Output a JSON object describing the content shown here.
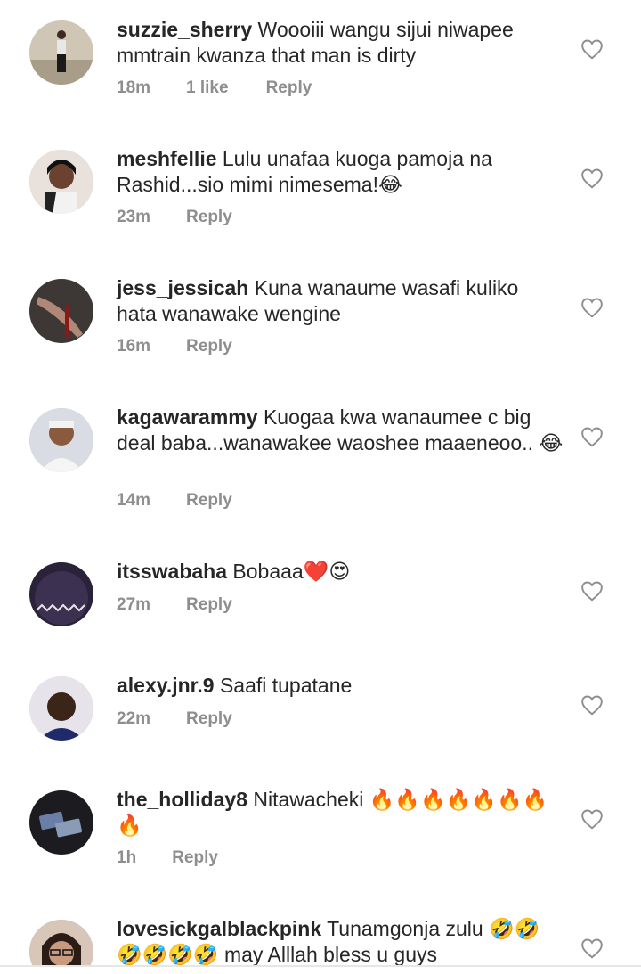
{
  "comments": [
    {
      "username": "suzzie_sherry",
      "text": "Woooiii wangu sijui niwapee mmtrain kwanza that man is dirty",
      "time": "18m",
      "likes": "1 like",
      "reply": "Reply"
    },
    {
      "username": "meshfellie",
      "text": "Lulu unafaa kuoga pamoja na Rashid...sio mimi nimesema!😂",
      "time": "23m",
      "likes": "",
      "reply": "Reply"
    },
    {
      "username": "jess_jessicah",
      "text": "Kuna wanaume wasafi kuliko hata wanawake wengine",
      "time": "16m",
      "likes": "",
      "reply": "Reply"
    },
    {
      "username": "kagawarammy",
      "text": "Kuogaa kwa wanaumee c big deal baba...wanawakee waoshee maaeneoo.. 😂",
      "time": "14m",
      "likes": "",
      "reply": "Reply"
    },
    {
      "username": "itsswabaha",
      "text": "Bobaaa❤️😍",
      "time": "27m",
      "likes": "",
      "reply": "Reply"
    },
    {
      "username": "alexy.jnr.9",
      "text": "Saafi tupatane",
      "time": "22m",
      "likes": "",
      "reply": "Reply"
    },
    {
      "username": "the_holliday8",
      "text": "Nitawacheki 🔥🔥🔥🔥🔥🔥🔥🔥",
      "time": "1h",
      "likes": "",
      "reply": "Reply"
    },
    {
      "username": "lovesickgalblackpink",
      "text": "Tunamgonja zulu 🤣🤣🤣🤣🤣🤣 may Alllah bless u guys",
      "time": "",
      "likes": "",
      "reply": ""
    }
  ],
  "icons": {
    "like": "heart-outline-icon"
  },
  "colors": {
    "meta": "#8e8e8e",
    "text": "#262626",
    "heart": "#8e8e8e"
  }
}
